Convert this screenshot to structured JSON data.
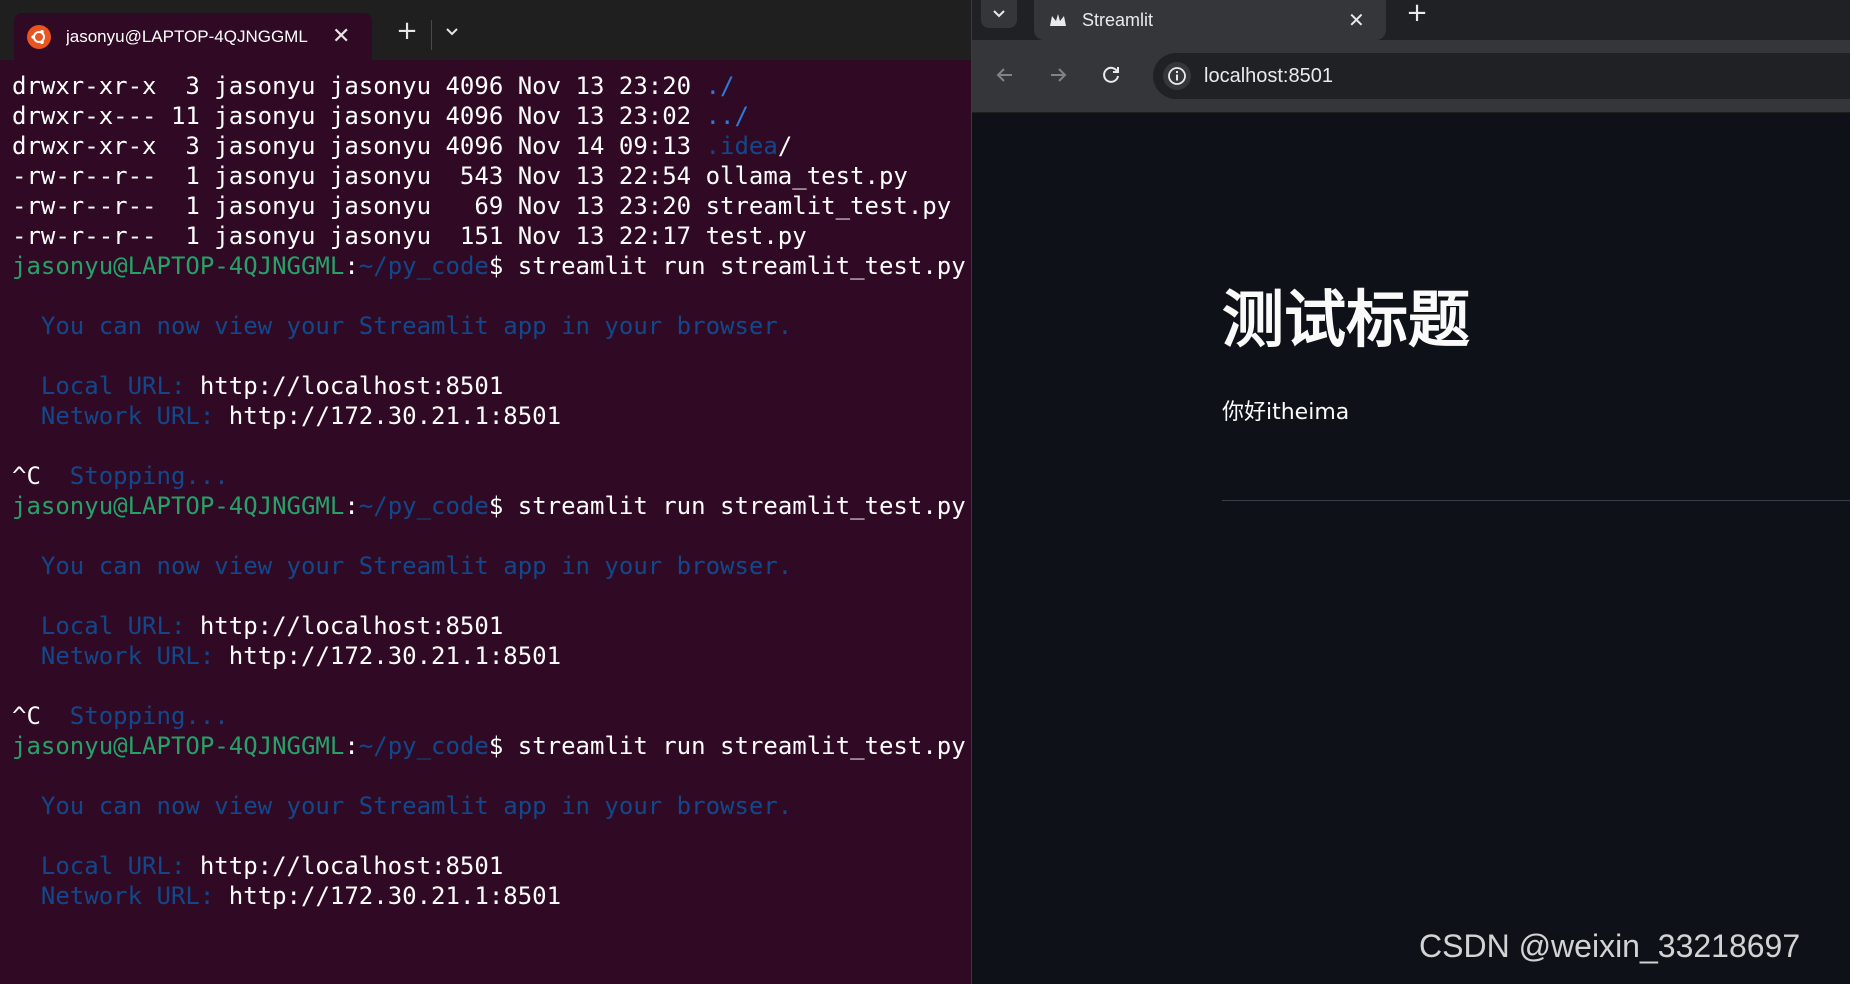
{
  "terminal": {
    "tab_title": "jasonyu@LAPTOP-4QJNGGML",
    "lines": [
      [
        {
          "t": "drwxr-xr-x  3 jasonyu jasonyu 4096 Nov 13 23:20 ",
          "c": "white"
        },
        {
          "t": "./",
          "c": "brt"
        }
      ],
      [
        {
          "t": "drwxr-x--- 11 jasonyu jasonyu 4096 Nov 13 23:02 ",
          "c": "white"
        },
        {
          "t": "../",
          "c": "brt"
        }
      ],
      [
        {
          "t": "drwxr-xr-x  3 jasonyu jasonyu 4096 Nov 14 09:13 ",
          "c": "white"
        },
        {
          "t": ".idea",
          "c": "blue"
        },
        {
          "t": "/",
          "c": "white"
        }
      ],
      [
        {
          "t": "-rw-r--r--  1 jasonyu jasonyu  543 Nov 13 22:54 ollama_test.py",
          "c": "white"
        }
      ],
      [
        {
          "t": "-rw-r--r--  1 jasonyu jasonyu   69 Nov 13 23:20 streamlit_test.py",
          "c": "white"
        }
      ],
      [
        {
          "t": "-rw-r--r--  1 jasonyu jasonyu  151 Nov 13 22:17 test.py",
          "c": "white"
        }
      ],
      [
        {
          "t": "jasonyu@LAPTOP-4QJNGGML",
          "c": "green"
        },
        {
          "t": ":",
          "c": "white"
        },
        {
          "t": "~/py_code",
          "c": "blue"
        },
        {
          "t": "$ streamlit run streamlit_test.py",
          "c": "white"
        }
      ],
      [
        {
          "t": "",
          "c": "white"
        }
      ],
      [
        {
          "t": "  You can now view your Streamlit app in your browser.",
          "c": "blue"
        }
      ],
      [
        {
          "t": "",
          "c": "white"
        }
      ],
      [
        {
          "t": "  Local URL: ",
          "c": "blue"
        },
        {
          "t": "http://localhost:8501",
          "c": "white"
        }
      ],
      [
        {
          "t": "  Network URL: ",
          "c": "blue"
        },
        {
          "t": "http://172.30.21.1:8501",
          "c": "white"
        }
      ],
      [
        {
          "t": "",
          "c": "white"
        }
      ],
      [
        {
          "t": "^C  ",
          "c": "white"
        },
        {
          "t": "Stopping...",
          "c": "blue"
        }
      ],
      [
        {
          "t": "jasonyu@LAPTOP-4QJNGGML",
          "c": "green"
        },
        {
          "t": ":",
          "c": "white"
        },
        {
          "t": "~/py_code",
          "c": "blue"
        },
        {
          "t": "$ streamlit run streamlit_test.py",
          "c": "white"
        }
      ],
      [
        {
          "t": "",
          "c": "white"
        }
      ],
      [
        {
          "t": "  You can now view your Streamlit app in your browser.",
          "c": "blue"
        }
      ],
      [
        {
          "t": "",
          "c": "white"
        }
      ],
      [
        {
          "t": "  Local URL: ",
          "c": "blue"
        },
        {
          "t": "http://localhost:8501",
          "c": "white"
        }
      ],
      [
        {
          "t": "  Network URL: ",
          "c": "blue"
        },
        {
          "t": "http://172.30.21.1:8501",
          "c": "white"
        }
      ],
      [
        {
          "t": "",
          "c": "white"
        }
      ],
      [
        {
          "t": "^C  ",
          "c": "white"
        },
        {
          "t": "Stopping...",
          "c": "blue"
        }
      ],
      [
        {
          "t": "jasonyu@LAPTOP-4QJNGGML",
          "c": "green"
        },
        {
          "t": ":",
          "c": "white"
        },
        {
          "t": "~/py_code",
          "c": "blue"
        },
        {
          "t": "$ streamlit run streamlit_test.py",
          "c": "white"
        }
      ],
      [
        {
          "t": "",
          "c": "white"
        }
      ],
      [
        {
          "t": "  You can now view your Streamlit app in your browser.",
          "c": "blue"
        }
      ],
      [
        {
          "t": "",
          "c": "white"
        }
      ],
      [
        {
          "t": "  Local URL: ",
          "c": "blue"
        },
        {
          "t": "http://localhost:8501",
          "c": "white"
        }
      ],
      [
        {
          "t": "  Network URL: ",
          "c": "blue"
        },
        {
          "t": "http://172.30.21.1:8501",
          "c": "white"
        }
      ]
    ]
  },
  "browser": {
    "tab_title": "Streamlit",
    "url": "localhost:8501",
    "page": {
      "title": "测试标题",
      "text": "你好itheima"
    }
  },
  "watermark": "CSDN @weixin_33218697",
  "colors": {
    "terminal_bg": "#300a24",
    "prompt_green": "#26a269",
    "path_blue": "#12488b",
    "streamlit_bg": "#0e1117",
    "ubuntu_orange": "#e95420"
  },
  "icons": {
    "terminal_tab": "ubuntu-logo-icon",
    "browser_tab": "streamlit-crown-icon"
  }
}
